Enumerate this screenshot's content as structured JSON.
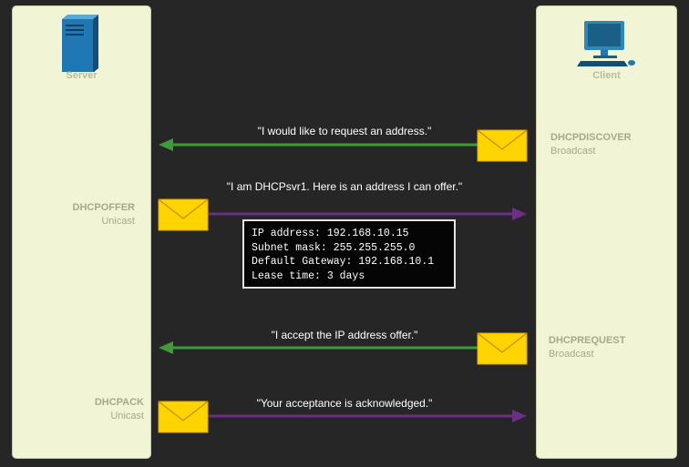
{
  "server": {
    "label": "Server",
    "icon": "server-icon"
  },
  "client": {
    "label": "Client",
    "icon": "computer-icon"
  },
  "colors": {
    "lane_bg": "#f2f4d6",
    "arrow_to_server": "#3f9a3a",
    "arrow_to_client": "#6b2f86",
    "envelope": "#ffd400",
    "message_label": "#a7a98c"
  },
  "messages": [
    {
      "type": "DHCPDISCOVER",
      "mode": "Broadcast",
      "quote": "\"I would like to request an address.\"",
      "direction": "client-to-server"
    },
    {
      "type": "DHCPOFFER",
      "mode": "Unicast",
      "quote": "\"I am DHCPsvr1. Here is an address I can offer.\"",
      "direction": "server-to-client"
    },
    {
      "type": "DHCPREQUEST",
      "mode": "Broadcast",
      "quote": "\"I accept the IP address offer.\"",
      "direction": "client-to-server"
    },
    {
      "type": "DHCPACK",
      "mode": "Unicast",
      "quote": "\"Your acceptance is acknowledged.\"",
      "direction": "server-to-client"
    }
  ],
  "offer_details": [
    "IP address: 192.168.10.15",
    "Subnet mask: 255.255.255.0",
    "Default Gateway: 192.168.10.1",
    "Lease time: 3 days"
  ]
}
